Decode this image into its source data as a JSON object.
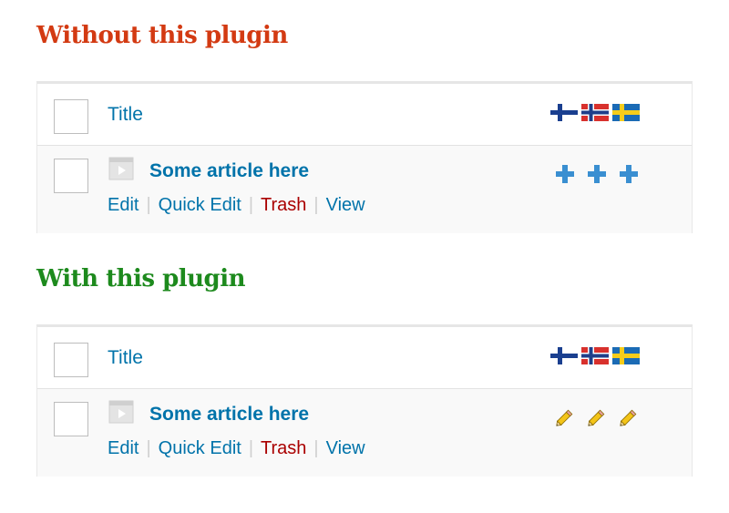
{
  "sections": [
    {
      "heading": "Without this plugin",
      "heading_color": "#d33a12",
      "column_title": "Title",
      "post_title": "Some article here",
      "status_icon": "plus-icon",
      "actions": {
        "edit": "Edit",
        "quick_edit": "Quick Edit",
        "trash": "Trash",
        "view": "View"
      }
    },
    {
      "heading": "With this plugin",
      "heading_color": "#1d8a1d",
      "column_title": "Title",
      "post_title": "Some article here",
      "status_icon": "pencil-icon",
      "actions": {
        "edit": "Edit",
        "quick_edit": "Quick Edit",
        "trash": "Trash",
        "view": "View"
      }
    }
  ],
  "language_flags": [
    "finland-flag-icon",
    "norway-flag-icon",
    "sweden-flag-icon"
  ],
  "colors": {
    "link": "#0073aa",
    "trash": "#aa0000"
  }
}
